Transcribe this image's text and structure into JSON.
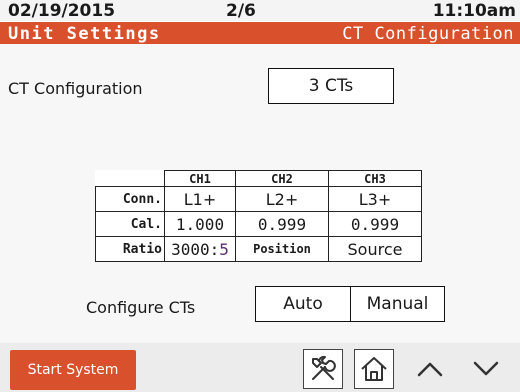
{
  "status": {
    "date": "02/19/2015",
    "page": "2/6",
    "time": "11:10am"
  },
  "title": {
    "left": "Unit Settings",
    "right": "CT Configuration"
  },
  "ct_config": {
    "label": "CT Configuration",
    "value": "3 CTs"
  },
  "table": {
    "headers": [
      "CH1",
      "CH2",
      "CH3"
    ],
    "rows": [
      {
        "label": "Conn.",
        "cells": [
          "L1+",
          "L2+",
          "L3+"
        ]
      },
      {
        "label": "Cal.",
        "cells": [
          "1.000",
          "0.999",
          "0.999"
        ]
      },
      {
        "label": "Ratio",
        "ratio_main": "3000:",
        "ratio_suffix": "5",
        "cells": [
          "Position",
          "Source"
        ]
      }
    ]
  },
  "configure": {
    "label": "Configure CTs",
    "auto": "Auto",
    "manual": "Manual"
  },
  "footer": {
    "start": "Start System"
  },
  "icons": [
    "tools-icon",
    "home-icon",
    "chevron-up-icon",
    "chevron-down-icon"
  ],
  "colors": {
    "accent": "#d9512c",
    "ratio_suffix": "#5a2d6d"
  }
}
